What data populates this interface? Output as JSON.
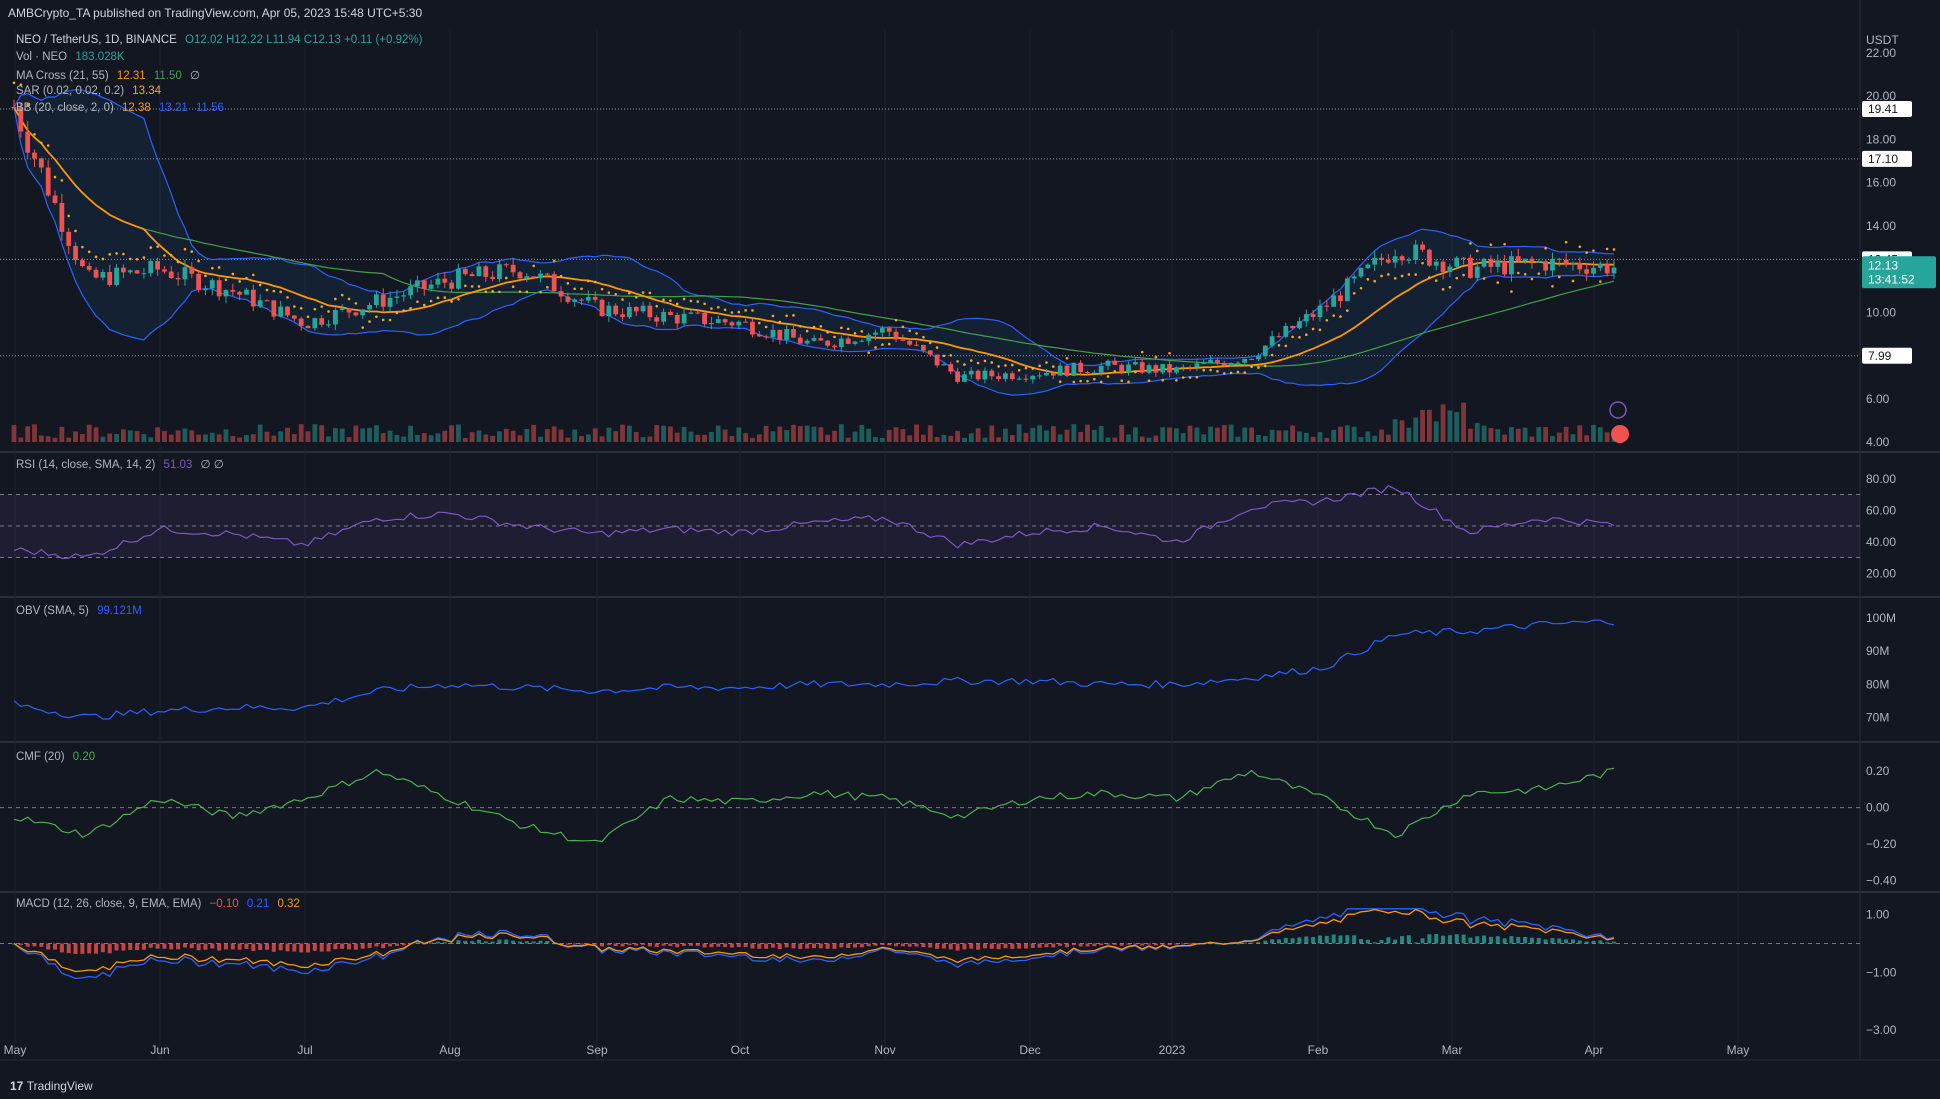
{
  "publish_line": "AMBCrypto_TA published on TradingView.com, Apr 05, 2023 15:48 UTC+5:30",
  "brand": "TradingView",
  "colors": {
    "bg": "#131722",
    "up": "#26a69a",
    "down": "#ef5350",
    "orange": "#ff9800",
    "blue": "#2962ff",
    "green": "#43a047",
    "sar": "#f9a825",
    "rsi": "#7e57c2",
    "cmf": "#4caf50"
  },
  "legend": {
    "symbol": "NEO / TetherUS, 1D, BINANCE",
    "ohlc": "O12.02  H12.22  L11.94  C12.13  +0.11 (+0.92%)",
    "vol_label": "Vol · NEO",
    "vol_value": "183.028K",
    "ma_label": "MA Cross (21, 55)",
    "ma_fast": "12.31",
    "ma_slow": "11.50",
    "ma_extra": "∅",
    "sar_label": "SAR (0.02, 0.02, 0.2)",
    "sar_value": "13.34",
    "bb_label": "BB (20, close, 2, 0)",
    "bb_mid": "12.38",
    "bb_up": "13.21",
    "bb_low": "11.56",
    "rsi_label": "RSI (14, close, SMA, 14, 2)",
    "rsi_value": "51.03",
    "rsi_extra": "∅ ∅",
    "obv_label": "OBV (SMA, 5)",
    "obv_value": "99.121M",
    "cmf_label": "CMF (20)",
    "cmf_value": "0.20",
    "macd_label": "MACD (12, 26, close, 9, EMA, EMA)",
    "macd_hist": "−0.10",
    "macd_line": "0.21",
    "macd_sig": "0.32"
  },
  "price_axis": {
    "currency": "USDT",
    "ticks": [
      "22.00",
      "20.00",
      "18.00",
      "16.00",
      "14.00",
      "10.00",
      "6.00",
      "4.00"
    ],
    "levels": [
      "19.41",
      "17.10",
      "12.45",
      "7.99"
    ],
    "last": "12.13",
    "countdown": "13:41:52"
  },
  "rsi_axis": [
    "80.00",
    "60.00",
    "40.00",
    "20.00"
  ],
  "obv_axis": [
    "100M",
    "90M",
    "80M",
    "70M"
  ],
  "cmf_axis": [
    "0.20",
    "0.00",
    "−0.20",
    "−0.40"
  ],
  "macd_axis": [
    "1.00",
    "−1.00",
    "−3.00"
  ],
  "time_axis": [
    "May",
    "Jun",
    "Jul",
    "Aug",
    "Sep",
    "Oct",
    "Nov",
    "Dec",
    "2023",
    "Feb",
    "Mar",
    "Apr",
    "May"
  ],
  "chart_data": {
    "type": "line",
    "x": [
      "2022-05",
      "2022-05-15",
      "2022-06",
      "2022-06-15",
      "2022-07",
      "2022-07-15",
      "2022-08",
      "2022-08-15",
      "2022-09",
      "2022-09-15",
      "2022-10",
      "2022-10-15",
      "2022-11",
      "2022-11-15",
      "2022-12",
      "2022-12-15",
      "2023-01",
      "2023-01-15",
      "2023-02",
      "2023-02-15",
      "2023-03",
      "2023-03-15",
      "2023-04"
    ],
    "series": [
      {
        "name": "NEO / TetherUS",
        "values": [
          19.5,
          11.5,
          12,
          11,
          9.5,
          10.5,
          11.5,
          12,
          10.2,
          9.8,
          9.5,
          8.5,
          9.2,
          7.0,
          7.2,
          7.5,
          7.3,
          8.0,
          10.2,
          13.0,
          12.0,
          12.3,
          12.1
        ]
      },
      {
        "name": "RSI",
        "values": [
          35,
          30,
          48,
          45,
          38,
          55,
          58,
          50,
          45,
          48,
          46,
          52,
          55,
          38,
          46,
          50,
          40,
          62,
          66,
          75,
          46,
          55,
          51
        ]
      },
      {
        "name": "OBV",
        "values": [
          74,
          70,
          72,
          73,
          73,
          78,
          80,
          79,
          78,
          79,
          79,
          80,
          80,
          81,
          81,
          80,
          80,
          82,
          85,
          95,
          96,
          98,
          99
        ]
      },
      {
        "name": "CMF",
        "values": [
          -0.05,
          -0.15,
          0.05,
          -0.05,
          0.05,
          0.2,
          0.05,
          -0.1,
          -0.2,
          0.05,
          0.03,
          0.08,
          0.05,
          -0.05,
          0.05,
          0.08,
          0.05,
          0.2,
          0.05,
          -0.15,
          0.08,
          0.1,
          0.2
        ]
      }
    ],
    "ylim": [
      4,
      22
    ]
  }
}
